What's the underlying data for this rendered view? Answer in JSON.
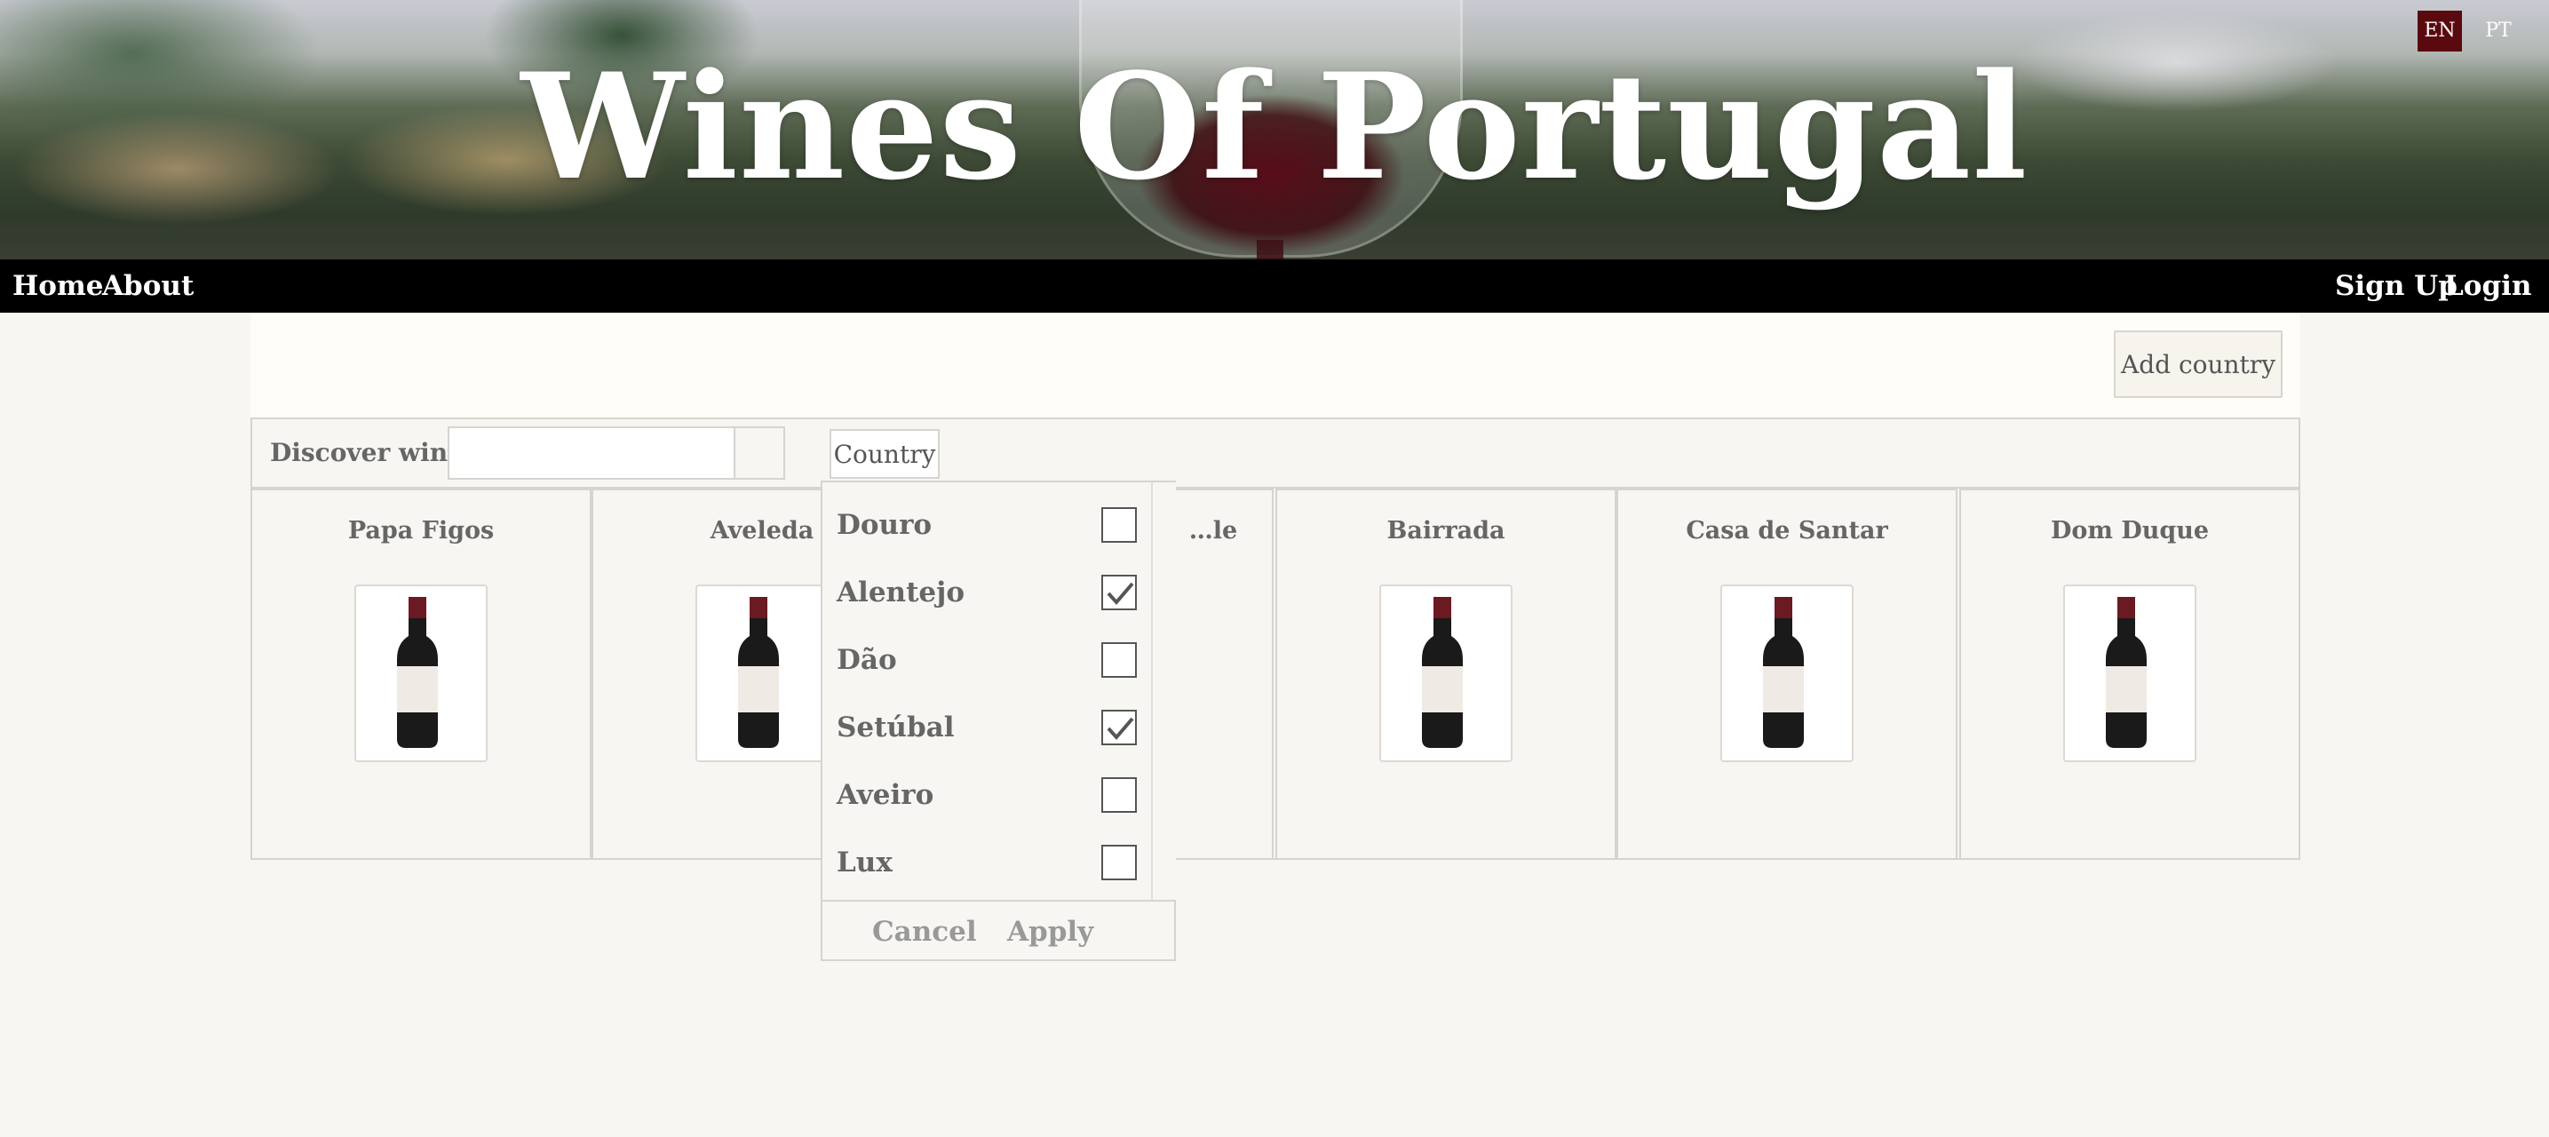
{
  "header": {
    "title": "Wines Of Portugal",
    "languages": [
      {
        "label": "EN",
        "active": true
      },
      {
        "label": "PT",
        "active": false
      }
    ]
  },
  "nav": {
    "home": "Home",
    "about": "About",
    "signup": "Sign Up",
    "login": "Login"
  },
  "toolbar": {
    "add_country": "Add country"
  },
  "filter": {
    "discover_label": "Discover wines",
    "search_value": "",
    "country_button": "Country"
  },
  "wines": [
    {
      "name": "Papa Figos"
    },
    {
      "name": "Aveleda"
    },
    {
      "name": "…le"
    },
    {
      "name": "Bairrada"
    },
    {
      "name": "Casa de Santar"
    },
    {
      "name": "Dom Duque"
    }
  ],
  "country_dropdown": {
    "options": [
      {
        "label": "Douro",
        "checked": false
      },
      {
        "label": "Alentejo",
        "checked": true
      },
      {
        "label": "Dão",
        "checked": false
      },
      {
        "label": "Setúbal",
        "checked": true
      },
      {
        "label": "Aveiro",
        "checked": false
      },
      {
        "label": "Lux",
        "checked": false
      }
    ],
    "cancel": "Cancel",
    "apply": "Apply"
  },
  "colors": {
    "accent": "#5a0a0f",
    "nav_bg": "#000000",
    "page_bg": "#f8f6f2"
  }
}
